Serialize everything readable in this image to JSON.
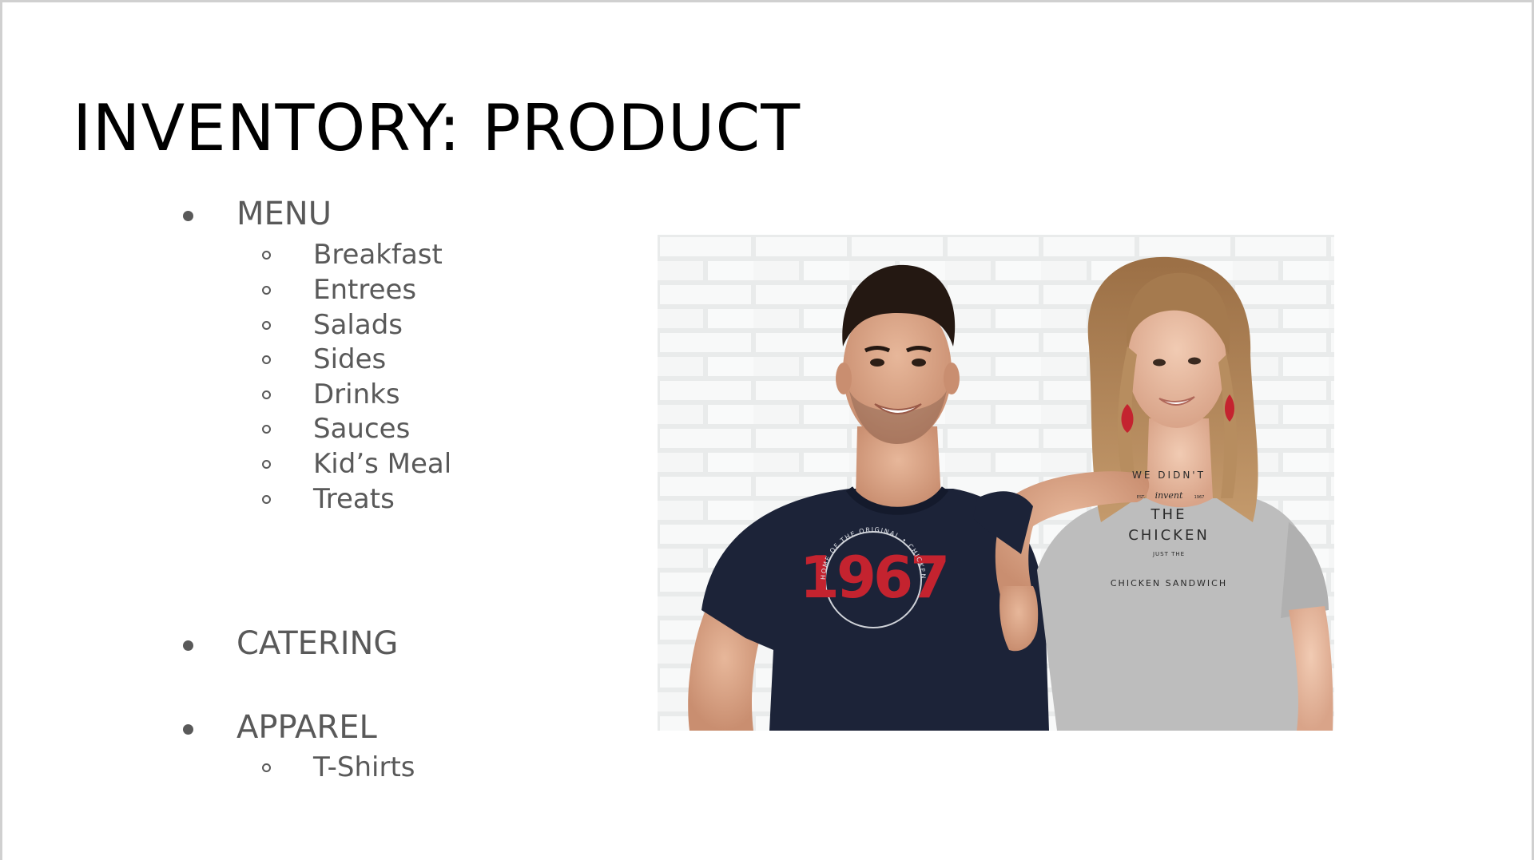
{
  "slide": {
    "title": "INVENTORY: PRODUCT",
    "sections": [
      {
        "label": "MENU",
        "items": [
          "Breakfast",
          "Entrees",
          "Salads",
          "Sides",
          "Drinks",
          "Sauces",
          "Kid’s Meal",
          "Treats"
        ]
      },
      {
        "label": "CATERING",
        "items": []
      },
      {
        "label": "APPAREL",
        "items": [
          "T-Shirts"
        ]
      }
    ]
  },
  "photo": {
    "shirt_left_text": {
      "big": "1967",
      "ring": "HOME OF THE ORIGINAL • CHICKEN SANDWICH •"
    },
    "shirt_right_text": {
      "arc_top": "WE DIDN'T",
      "small": "invent",
      "est": "EST.",
      "year": "1967",
      "line1": "THE",
      "line2": "CHICKEN",
      "line3": "JUST THE",
      "arc_bottom": "CHICKEN SANDWICH"
    },
    "colors": {
      "navy_shirt": "#1c2338",
      "grey_shirt": "#b9b9b9",
      "red_print": "#c4232f",
      "brick_wall": "#eceeee"
    }
  }
}
